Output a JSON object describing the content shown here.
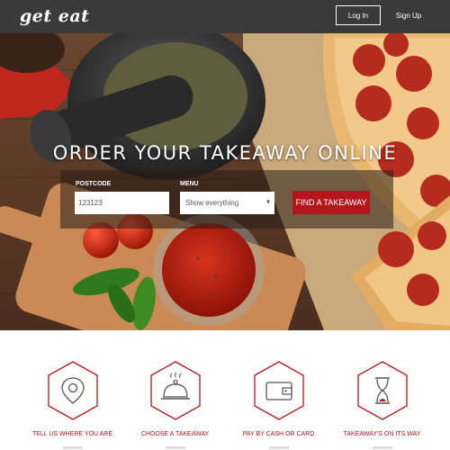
{
  "header": {
    "logo": "get eat",
    "login_label": "Log In",
    "signup_label": "Sign Up"
  },
  "hero": {
    "title": "ORDER YOUR TAKEAWAY ONLINE",
    "postcode_label": "POSTCODE",
    "postcode_value": "123123",
    "menu_label": "MENU",
    "menu_selected": "Show everything",
    "find_button": "FIND A TAKEAWAY"
  },
  "steps": [
    {
      "label": "TELL US WHERE YOU ARE",
      "icon": "location-pin-icon"
    },
    {
      "label": "CHOOSE A TAKEAWAY",
      "icon": "food-cloche-icon"
    },
    {
      "label": "PAY BY CASH OR CARD",
      "icon": "wallet-icon"
    },
    {
      "label": "TAKEAWAY'S ON ITS WAY",
      "icon": "hourglass-icon"
    }
  ],
  "colors": {
    "accent": "#b5161c",
    "topbar": "#3a3a3a"
  }
}
